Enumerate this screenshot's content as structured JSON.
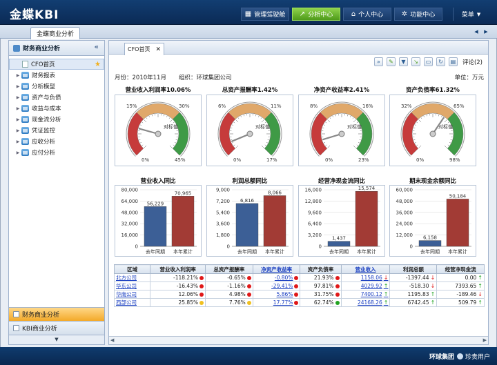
{
  "app": {
    "logo": "金蝶KBI"
  },
  "topnav": [
    {
      "label": "管理驾驶舱",
      "icon": "dashboard-icon",
      "active": false
    },
    {
      "label": "分析中心",
      "icon": "trend-icon",
      "active": true
    },
    {
      "label": "个人中心",
      "icon": "home-icon",
      "active": false
    },
    {
      "label": "功能中心",
      "icon": "gear-icon",
      "active": false
    }
  ],
  "menu_label": "菜单",
  "module_tab": "金蝶商业分析",
  "sidebar": {
    "title": "财务商业分析",
    "items": [
      {
        "label": "CFO首页",
        "selected": true
      },
      {
        "label": "财务报表"
      },
      {
        "label": "分析模型"
      },
      {
        "label": "资产与负债"
      },
      {
        "label": "收益与成本"
      },
      {
        "label": "现金流分析"
      },
      {
        "label": "凭证监控"
      },
      {
        "label": "应收分析"
      },
      {
        "label": "应付分析"
      }
    ],
    "bottom": [
      {
        "label": "财务商业分析",
        "active": true
      },
      {
        "label": "KBI商业分析",
        "active": false
      }
    ]
  },
  "main": {
    "tab": "CFO首页",
    "comment_label": "评论(2)",
    "period": "月份：2010年11月",
    "org": "组织：环球集团公司",
    "unit": "单位：万元"
  },
  "gauges": [
    {
      "title": "营业收入利润率10.06%",
      "min_label": "0%",
      "max_label": "45%",
      "mid_left": "15%",
      "mid_right": "30%",
      "bench_label": "对标值",
      "value": 10.06,
      "max": 45
    },
    {
      "title": "总资产报酬率1.42%",
      "min_label": "0%",
      "max_label": "17%",
      "mid_left": "6%",
      "mid_right": "11%",
      "bench_label": "对标值",
      "value": 1.42,
      "max": 17
    },
    {
      "title": "净资产收益率2.41%",
      "min_label": "0%",
      "max_label": "23%",
      "mid_left": "8%",
      "mid_right": "16%",
      "bench_label": "对标值",
      "value": 2.41,
      "max": 23
    },
    {
      "title": "资产负债率61.32%",
      "min_label": "0%",
      "max_label": "98%",
      "mid_left": "32%",
      "mid_right": "65%",
      "bench_label": "对标值",
      "value": 61.32,
      "max": 98
    }
  ],
  "chart_data": [
    {
      "type": "bar",
      "title": "营业收入同比",
      "categories": [
        "去年同期",
        "本年累计"
      ],
      "values": [
        56229,
        70965
      ],
      "value_labels": [
        "56,229",
        "70,965"
      ],
      "ylim": [
        0,
        80000
      ],
      "yticks": [
        "80,000",
        "64,000",
        "48,000",
        "32,000",
        "16,000",
        "0"
      ]
    },
    {
      "type": "bar",
      "title": "利润总额同比",
      "categories": [
        "去年同期",
        "本年累计"
      ],
      "values": [
        6816,
        8066
      ],
      "value_labels": [
        "6,816",
        "8,066"
      ],
      "ylim": [
        0,
        9000
      ],
      "yticks": [
        "9,000",
        "7,200",
        "5,400",
        "3,600",
        "1,800",
        "0"
      ]
    },
    {
      "type": "bar",
      "title": "经营净现金流同比",
      "categories": [
        "去年同期",
        "本年累计"
      ],
      "values": [
        1437,
        15574
      ],
      "value_labels": [
        "1,437",
        "15,574"
      ],
      "ylim": [
        0,
        16000
      ],
      "yticks": [
        "16,000",
        "12,800",
        "9,600",
        "6,400",
        "3,200",
        "0"
      ]
    },
    {
      "type": "bar",
      "title": "期末现金余额同比",
      "categories": [
        "去年同期",
        "本年累计"
      ],
      "values": [
        6158,
        50184
      ],
      "value_labels": [
        "6,158",
        "50,184"
      ],
      "ylim": [
        0,
        60000
      ],
      "yticks": [
        "60,000",
        "48,000",
        "36,000",
        "24,000",
        "12,000",
        "0"
      ]
    }
  ],
  "colors": {
    "bar_last": "#3c5f96",
    "bar_this": "#a23b35",
    "red": "#e01818",
    "green": "#21a321",
    "yellow": "#f0c020"
  },
  "table": {
    "headers": [
      "区域",
      "营业收入利润率",
      "总资产报酬率",
      "净资产收益率",
      "资产负债率",
      "营业收入",
      "利润总额",
      "经营净现金流"
    ],
    "rows": [
      {
        "region": "北方公司",
        "c1": "-118.21%",
        "d1": "red",
        "c2": "-0.65%",
        "d2": "red",
        "c3": "-0.80%",
        "d3": "red",
        "c4": "21.93%",
        "d4": "red",
        "c5": "1158.06",
        "a5": "down",
        "c6": "-1397.44",
        "a6": "down",
        "c7": "0.00",
        "a7": "up"
      },
      {
        "region": "华东公司",
        "c1": "-16.43%",
        "d1": "red",
        "c2": "-1.16%",
        "d2": "red",
        "c3": "-29.41%",
        "d3": "red",
        "c4": "97.81%",
        "d4": "red",
        "c5": "4029.92",
        "a5": "up",
        "c6": "-518.30",
        "a6": "down",
        "c7": "7393.65",
        "a7": "up"
      },
      {
        "region": "华南公司",
        "c1": "12.06%",
        "d1": "red",
        "c2": "4.98%",
        "d2": "red",
        "c3": "5.86%",
        "d3": "red",
        "c4": "31.75%",
        "d4": "red",
        "c5": "7400.12",
        "a5": "up",
        "c6": "1195.83",
        "a6": "up",
        "c7": "-189.46",
        "a7": "down"
      },
      {
        "region": "西部公司",
        "c1": "25.85%",
        "d1": "yellow",
        "c2": "7.76%",
        "d2": "yellow",
        "c3": "17.77%",
        "d3": "red",
        "c4": "62.74%",
        "d4": "green",
        "c5": "24168.26",
        "a5": "up",
        "c6": "6742.45",
        "a6": "up",
        "c7": "509.79",
        "a7": "up"
      }
    ]
  },
  "status": {
    "org": "环球集团",
    "user": "珍贵用户"
  }
}
